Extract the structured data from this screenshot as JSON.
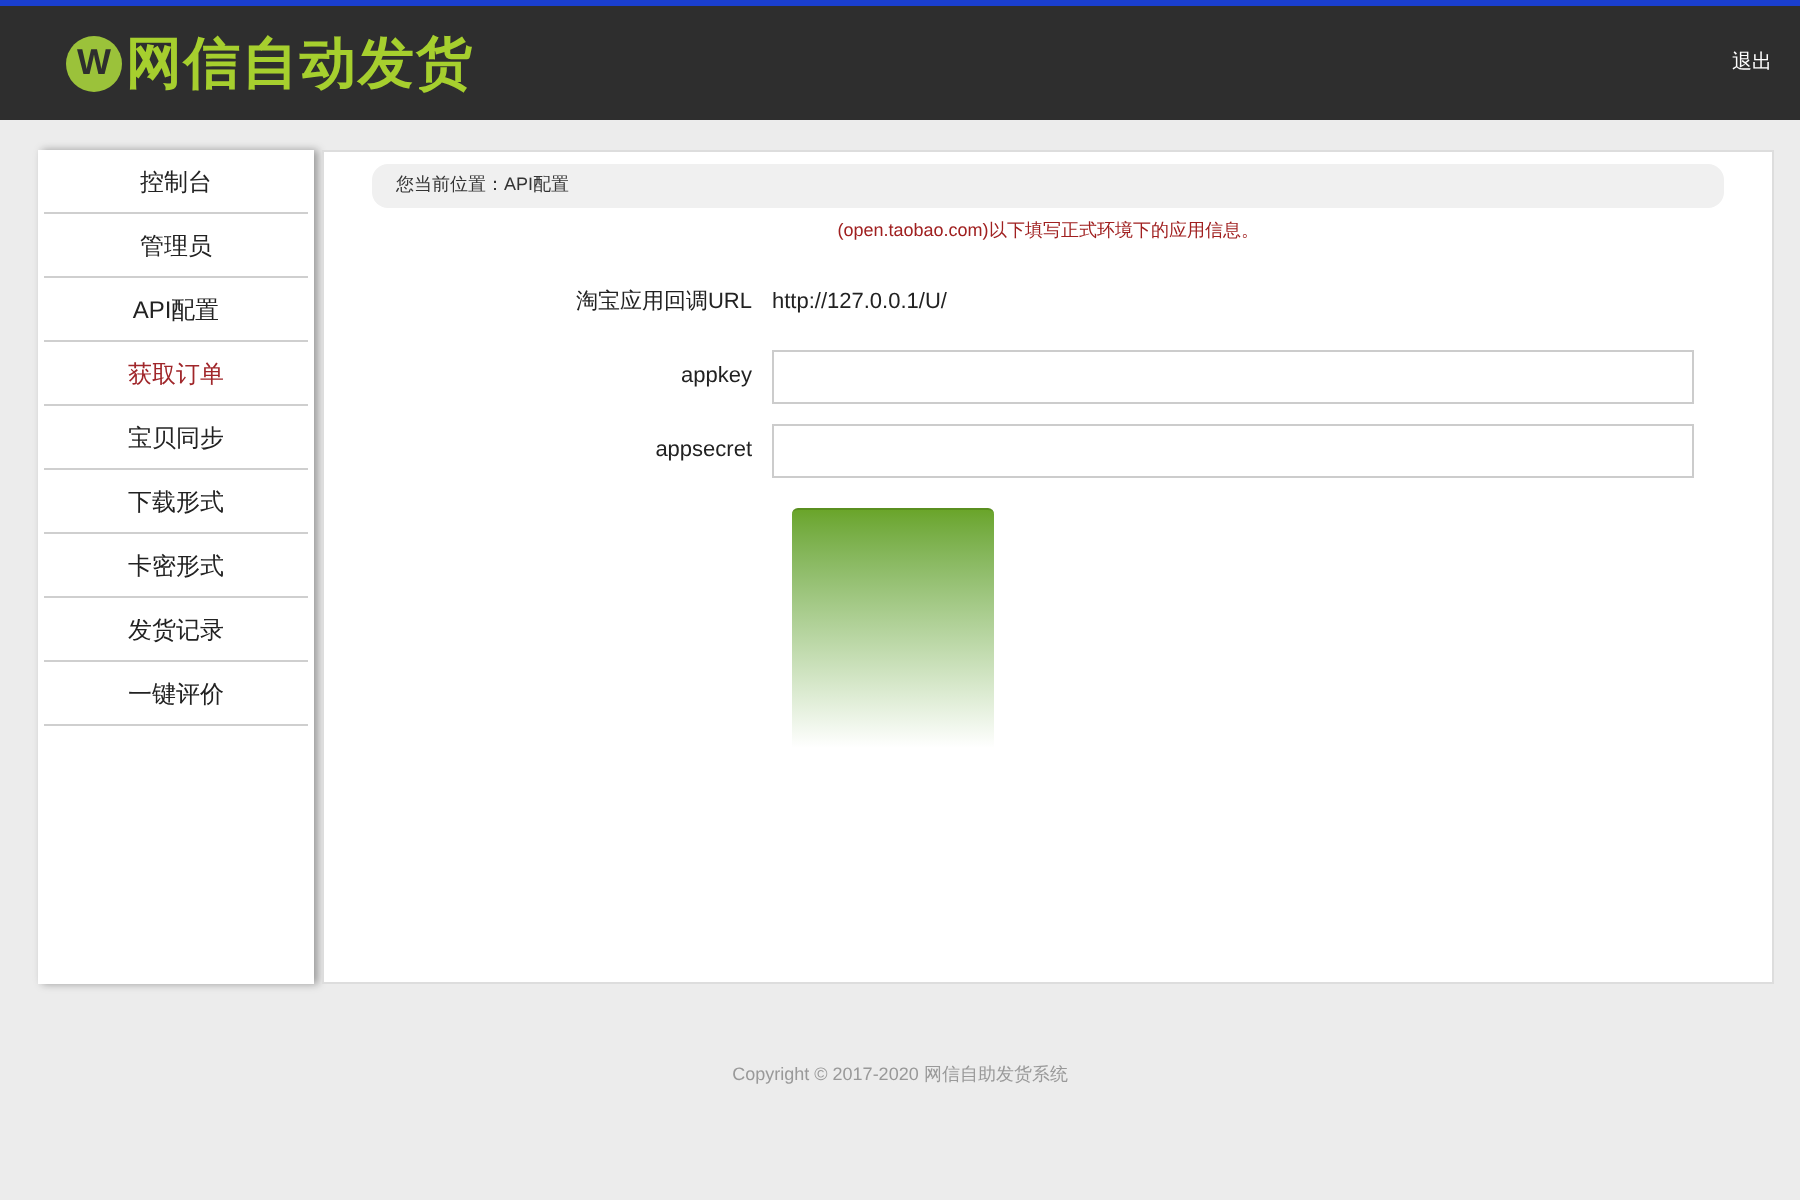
{
  "header": {
    "logo_mark": "W",
    "title": "网信自动发货",
    "logout": "退出"
  },
  "sidebar": {
    "items": [
      {
        "label": "控制台",
        "selected": false
      },
      {
        "label": "管理员",
        "selected": false
      },
      {
        "label": "API配置",
        "selected": false
      },
      {
        "label": "获取订单",
        "selected": true
      },
      {
        "label": "宝贝同步",
        "selected": false
      },
      {
        "label": "下载形式",
        "selected": false
      },
      {
        "label": "卡密形式",
        "selected": false
      },
      {
        "label": "发货记录",
        "selected": false
      },
      {
        "label": "一键评价",
        "selected": false
      }
    ]
  },
  "breadcrumb": "您当前位置：API配置",
  "notice": "(open.taobao.com)以下填写正式环境下的应用信息。",
  "form": {
    "rows": [
      {
        "kind": "static",
        "label": "淘宝应用回调URL",
        "value": "http://127.0.0.1/U/"
      },
      {
        "kind": "input",
        "label": "appkey"
      },
      {
        "kind": "input",
        "label": "appsecret"
      }
    ]
  },
  "footer": "Copyright © 2017-2020 网信自助发货系统"
}
